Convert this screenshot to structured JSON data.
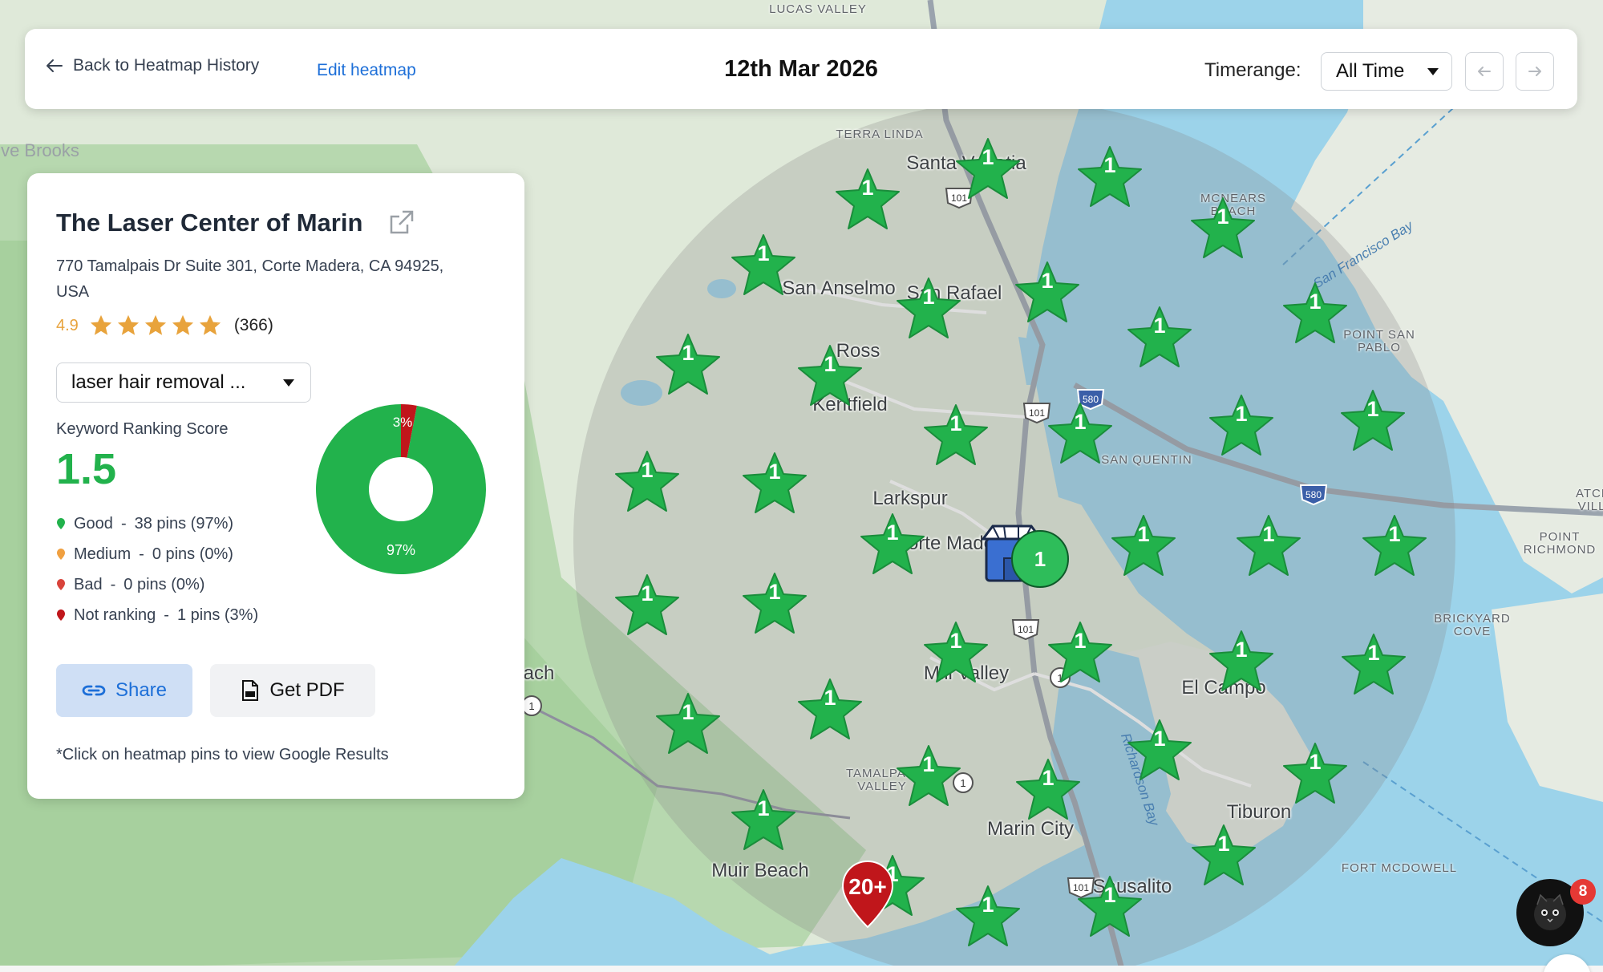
{
  "header": {
    "back_label": "Back to Heatmap History",
    "edit_label": "Edit heatmap",
    "date": "12th Mar 2026",
    "timerange_label": "Timerange:",
    "timerange_value": "All Time"
  },
  "business": {
    "name": "The Laser Center of Marin",
    "address": "770 Tamalpais Dr Suite 301, Corte Madera, CA 94925, USA",
    "rating": "4.9",
    "rating_value": 4.9,
    "review_count": "(366)"
  },
  "keyword": {
    "selected": "laser hair removal ..."
  },
  "score": {
    "label": "Keyword Ranking Score",
    "value": "1.5"
  },
  "legend": [
    {
      "name": "Good",
      "text": "38 pins (97%)",
      "color": "#22b24c"
    },
    {
      "name": "Medium",
      "text": "0 pins (0%)",
      "color": "#f0a040"
    },
    {
      "name": "Bad",
      "text": "0 pins (0%)",
      "color": "#d9443b"
    },
    {
      "name": "Not ranking",
      "text": "1 pins (3%)",
      "color": "#c0161b"
    }
  ],
  "donut": {
    "good_pct": 97,
    "notranking_pct": 3,
    "good_label": "97%",
    "notranking_label": "3%"
  },
  "actions": {
    "share_label": "Share",
    "pdf_label": "Get PDF",
    "hint": "*Click on heatmap pins to view Google Results"
  },
  "map": {
    "places": [
      {
        "name": "LUCAS VALLEY",
        "cls": "small"
      },
      {
        "name": "ve Brooks",
        "cls": "faint"
      },
      {
        "name": "TERRA LINDA",
        "cls": "small"
      },
      {
        "name": "Santa Venetia",
        "cls": "city"
      },
      {
        "name": "MCNEARS BEACH",
        "cls": "small"
      },
      {
        "name": "San Anselmo",
        "cls": "city"
      },
      {
        "name": "San Rafael",
        "cls": "city"
      },
      {
        "name": "Ross",
        "cls": "city"
      },
      {
        "name": "Kentfield",
        "cls": "city"
      },
      {
        "name": "POINT SAN PABLO",
        "cls": "small"
      },
      {
        "name": "SAN QUENTIN",
        "cls": "small"
      },
      {
        "name": "Larkspur",
        "cls": "city"
      },
      {
        "name": "Corte Madera",
        "cls": "city"
      },
      {
        "name": "POINT RICHMOND",
        "cls": "small"
      },
      {
        "name": "ATCH VILL",
        "cls": "small"
      },
      {
        "name": "BRICKYARD COVE",
        "cls": "small"
      },
      {
        "name": "ach",
        "cls": "city"
      },
      {
        "name": "Mill Valley",
        "cls": "city"
      },
      {
        "name": "El Campo",
        "cls": "city"
      },
      {
        "name": "TAMALPAIS VALLEY",
        "cls": "small"
      },
      {
        "name": "Tiburon",
        "cls": "city"
      },
      {
        "name": "Marin City",
        "cls": "city"
      },
      {
        "name": "FORT MCDOWELL",
        "cls": "small"
      },
      {
        "name": "Muir Beach",
        "cls": "city"
      },
      {
        "name": "Sausalito",
        "cls": "city"
      },
      {
        "name": "Richardson Bay",
        "cls": "water"
      },
      {
        "name": "San Francisco Bay",
        "cls": "water"
      }
    ],
    "good_pin_label": "1",
    "good_pin_count": 38,
    "center_pin_label": "1",
    "notranking_pin_label": "20+"
  },
  "chat": {
    "badge": "8"
  }
}
